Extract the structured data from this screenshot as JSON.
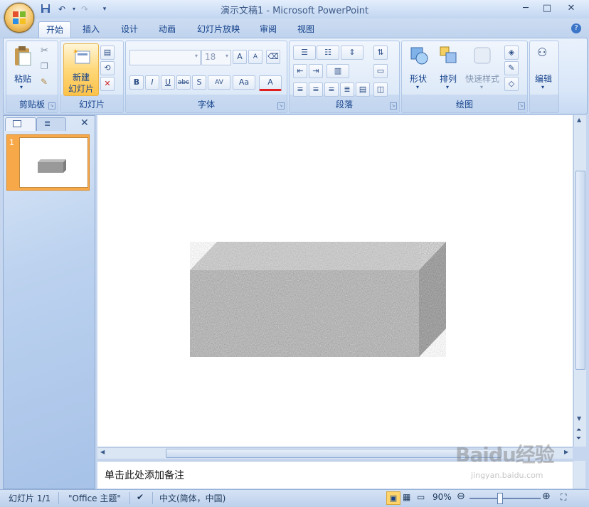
{
  "title": "演示文稿1 - Microsoft PowerPoint",
  "window_controls": {
    "minimize": "─",
    "maximize": "□",
    "close": "✕"
  },
  "tabs": [
    "开始",
    "插入",
    "设计",
    "动画",
    "幻灯片放映",
    "审阅",
    "视图"
  ],
  "ribbon": {
    "clipboard": {
      "paste": "粘贴",
      "label": "剪贴板"
    },
    "slides": {
      "new_slide_line1": "新建",
      "new_slide_line2": "幻灯片",
      "label": "幻灯片"
    },
    "font": {
      "font_size": "18",
      "label": "字体",
      "bold": "B",
      "italic": "I",
      "underline": "U",
      "strike": "abc",
      "shadow": "S",
      "spacing": "AV",
      "case": "Aa",
      "color": "A",
      "grow": "A",
      "shrink": "A"
    },
    "paragraph": {
      "label": "段落"
    },
    "drawing": {
      "shapes": "形状",
      "arrange": "排列",
      "quick_styles": "快速样式",
      "label": "绘图"
    },
    "editing": {
      "label": "编辑"
    }
  },
  "slide_panel": {
    "slide_number": "1"
  },
  "notes_placeholder": "单击此处添加备注",
  "status": {
    "slide": "幻灯片 1/1",
    "theme": "\"Office 主题\"",
    "language": "中文(简体，中国)",
    "zoom": "90%"
  },
  "watermark": "Baidu经验",
  "watermark_sub": "jingyan.baidu.com",
  "colors": {
    "accent": "#15428b",
    "thumb_selected": "#f7a94a"
  }
}
